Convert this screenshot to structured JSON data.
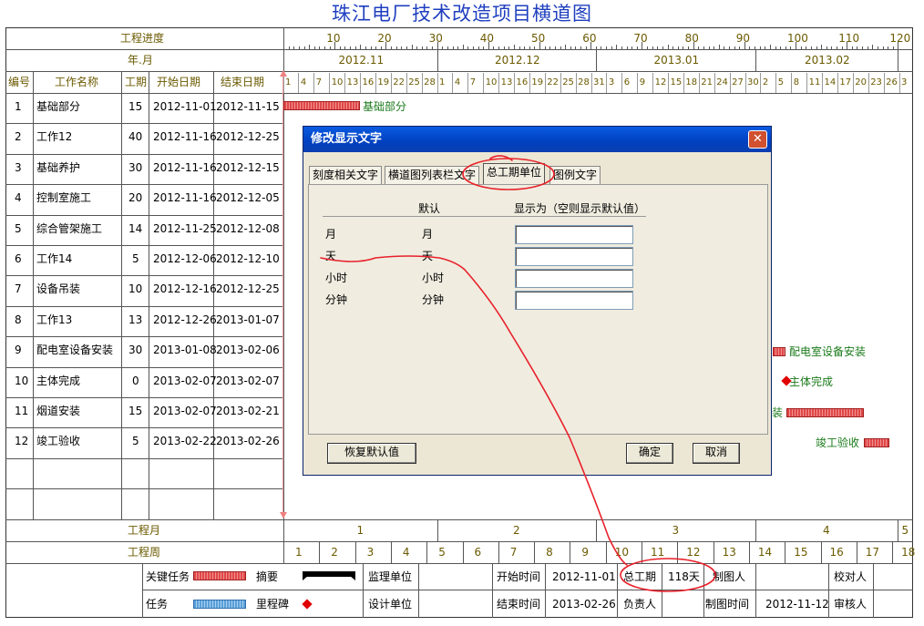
{
  "title": "珠江电厂技术改造项目横道图",
  "header": {
    "progress_label": "工程进度",
    "yearmonth_label": "年.月",
    "progress_scale": [
      "10",
      "20",
      "30",
      "40",
      "50",
      "60",
      "70",
      "80",
      "90",
      "100",
      "110",
      "120"
    ],
    "months": [
      "2012.11",
      "2012.12",
      "2013.01",
      "2013.02"
    ],
    "day_ticks": [
      "1",
      "4",
      "7",
      "10",
      "13",
      "16",
      "19",
      "22",
      "25",
      "28",
      "1",
      "4",
      "7",
      "10",
      "13",
      "16",
      "19",
      "22",
      "25",
      "28",
      "31",
      "3",
      "6",
      "9",
      "12",
      "15",
      "18",
      "21",
      "24",
      "27",
      "30",
      "2",
      "5",
      "8",
      "11",
      "14",
      "17",
      "20",
      "23",
      "26",
      "3"
    ]
  },
  "columns": {
    "id": "编号",
    "name": "工作名称",
    "duration": "工期",
    "start": "开始日期",
    "end": "结束日期"
  },
  "tasks": [
    {
      "id": "1",
      "name": "基础部分",
      "duration": "15",
      "start": "2012-11-01",
      "end": "2012-11-15"
    },
    {
      "id": "2",
      "name": "工作12",
      "duration": "40",
      "start": "2012-11-16",
      "end": "2012-12-25"
    },
    {
      "id": "3",
      "name": "基础养护",
      "duration": "30",
      "start": "2012-11-16",
      "end": "2012-12-15"
    },
    {
      "id": "4",
      "name": "控制室施工",
      "duration": "20",
      "start": "2012-11-16",
      "end": "2012-12-05"
    },
    {
      "id": "5",
      "name": "综合管架施工",
      "duration": "14",
      "start": "2012-11-25",
      "end": "2012-12-08"
    },
    {
      "id": "6",
      "name": "工作14",
      "duration": "5",
      "start": "2012-12-06",
      "end": "2012-12-10"
    },
    {
      "id": "7",
      "name": "设备吊装",
      "duration": "10",
      "start": "2012-12-16",
      "end": "2012-12-25"
    },
    {
      "id": "8",
      "name": "工作13",
      "duration": "13",
      "start": "2012-12-26",
      "end": "2013-01-07"
    },
    {
      "id": "9",
      "name": "配电室设备安装",
      "duration": "30",
      "start": "2013-01-08",
      "end": "2013-02-06"
    },
    {
      "id": "10",
      "name": "主体完成",
      "duration": "0",
      "start": "2013-02-07",
      "end": "2013-02-07"
    },
    {
      "id": "11",
      "name": "烟道安装",
      "duration": "15",
      "start": "2013-02-07",
      "end": "2013-02-21"
    },
    {
      "id": "12",
      "name": "竣工验收",
      "duration": "5",
      "start": "2013-02-22",
      "end": "2013-02-26"
    }
  ],
  "gantt_labels": {
    "t1": "基础部分",
    "t9": "配电室设备安装",
    "t10": "主体完成",
    "t11": "装",
    "t12": "竣工验收"
  },
  "footer": {
    "month_label": "工程月",
    "week_label": "工程周",
    "month_nums": [
      "1",
      "2",
      "3",
      "4",
      "5"
    ],
    "week_nums": [
      "1",
      "2",
      "3",
      "4",
      "5",
      "6",
      "7",
      "8",
      "9",
      "10",
      "11",
      "12",
      "13",
      "14",
      "15",
      "16",
      "17",
      "18"
    ]
  },
  "legend": {
    "critical": "关键任务",
    "summary": "摘要",
    "task": "任务",
    "milestone": "里程碑",
    "supervisor": "监理单位",
    "designer": "设计单位",
    "start_time_label": "开始时间",
    "start_time": "2012-11-01",
    "end_time_label": "结束时间",
    "end_time": "2013-02-26",
    "total_label": "总工期",
    "total": "118天",
    "responsible": "负责人",
    "drawer": "制图人",
    "draw_time_label": "制图时间",
    "draw_time": "2012-11-12",
    "checker": "校对人",
    "reviewer": "审核人"
  },
  "dialog": {
    "title": "修改显示文字",
    "close": "✕",
    "tabs": [
      "刻度相关文字",
      "横道图列表栏文字",
      "总工期单位",
      "图例文字"
    ],
    "col_default": "默认",
    "col_display": "显示为（空则显示默认值）",
    "rows": [
      {
        "unit": "月",
        "default": "月",
        "value": ""
      },
      {
        "unit": "天",
        "default": "天",
        "value": ""
      },
      {
        "unit": "小时",
        "default": "小时",
        "value": ""
      },
      {
        "unit": "分钟",
        "default": "分钟",
        "value": ""
      }
    ],
    "restore_button": "恢复默认值",
    "ok_button": "确定",
    "cancel_button": "取消"
  },
  "colors": {
    "critical": "#e04848",
    "task": "#66aadd",
    "annotation": "#e8202a",
    "title": "#1f3fbf",
    "dialog_title": "#0040c0"
  }
}
